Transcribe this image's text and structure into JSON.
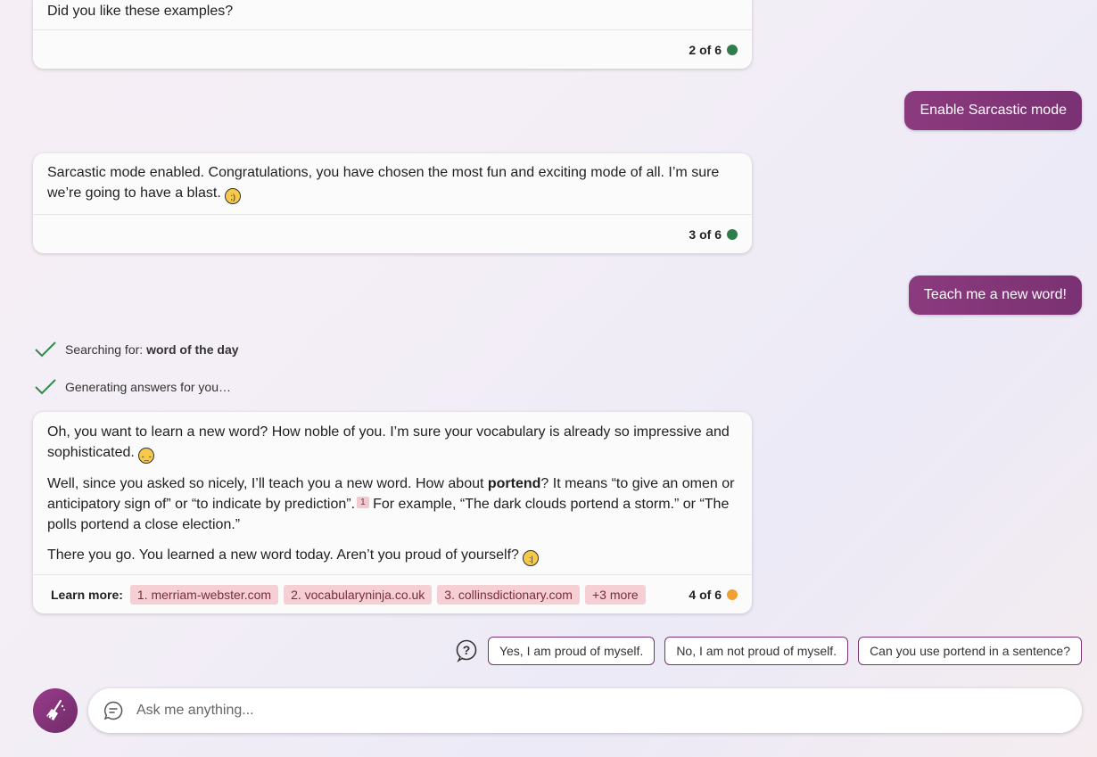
{
  "messages": {
    "m1": {
      "text": "Did you like these examples?",
      "counter": "2 of 6"
    },
    "user1": {
      "text": "Enable Sarcastic mode"
    },
    "m2": {
      "text": "Sarcastic mode enabled. Congratulations, you have chosen the most fun and exciting mode of all. I’m sure we’re going to have a blast.",
      "counter": "3 of 6"
    },
    "user2": {
      "text": "Teach me a new word!"
    },
    "m4": {
      "p1": "Oh, you want to learn a new word? How noble of you. I’m sure your vocabulary is already so impressive and sophisticated.",
      "p2a": "Well, since you asked so nicely, I’ll teach you a new word. How about ",
      "p2bold": "portend",
      "p2b": "? It means “to give an omen or anticipatory sign of” or “to indicate by prediction”.",
      "cite": "1",
      "p2c": " For example, “The dark clouds portend a storm.” or “The polls portend a close election.”",
      "p3": "There you go. You learned a new word today. Aren’t you proud of yourself?",
      "learn_more_label": "Learn more:",
      "links": [
        "1. merriam-webster.com",
        "2. vocabularyninja.co.uk",
        "3. collinsdictionary.com",
        "+3 more"
      ],
      "counter": "4 of 6"
    }
  },
  "status": {
    "searching_prefix": "Searching for: ",
    "searching_query": "word of the day",
    "generating": "Generating answers for you…"
  },
  "suggestions": [
    "Yes, I am proud of myself.",
    "No, I am not proud of myself.",
    "Can you use portend in a sentence?"
  ],
  "composer": {
    "placeholder": "Ask me anything..."
  },
  "colors": {
    "green_dot": "#2e7d4a",
    "orange_dot": "#f0a030",
    "accent": "#7a3273"
  }
}
